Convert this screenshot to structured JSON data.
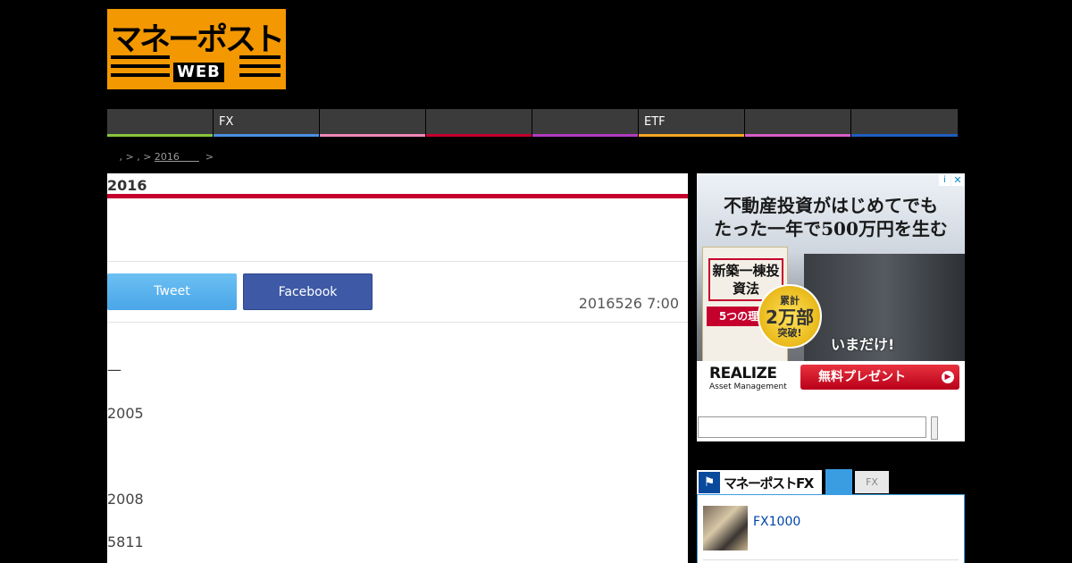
{
  "header": {
    "logo_text": "マネーポスト",
    "logo_sub": "WEB"
  },
  "nav": {
    "items": [
      {
        "label": "",
        "color": "#8ac43f"
      },
      {
        "label": "FX",
        "color": "#4a90e2"
      },
      {
        "label": "",
        "color": "#f088b6"
      },
      {
        "label": "",
        "color": "#c5002d"
      },
      {
        "label": "",
        "color": "#b03bbf"
      },
      {
        "label": "ETF",
        "color": "#f5a623"
      },
      {
        "label": "",
        "color": "#d65fc6"
      },
      {
        "label": "",
        "color": "#1f5fbf"
      }
    ]
  },
  "breadcrumb": {
    "prefix": " , > , > ",
    "link": "2016　　",
    "suffix": "  >"
  },
  "article": {
    "title": "2016",
    "tweet_label": "Tweet",
    "facebook_label": "Facebook",
    "date": "2016526 7:00",
    "dash": "—",
    "lines": [
      "2005",
      "2008",
      "5811"
    ]
  },
  "ad": {
    "headline1": "不動産投資がはじめてでも",
    "headline2": "たった一年で500万円を生む",
    "book_title": "新築一棟投資法",
    "book_band": "5つの理由",
    "badge_top": "累計",
    "badge_big": "2万部",
    "badge_bottom": "突破!",
    "now_text": "いまだけ!",
    "brand": "REALIZE",
    "brand_sub": "Asset Management",
    "cta": "無料プレゼント",
    "cta_arrow": "▶",
    "info_glyph": "i",
    "close_glyph": "✕"
  },
  "search": {
    "placeholder": ""
  },
  "fx_widget": {
    "logo_icon": "⚑",
    "logo_text": "マネーポストFX",
    "tab_fx": "FX",
    "item_title": "FX1000"
  }
}
